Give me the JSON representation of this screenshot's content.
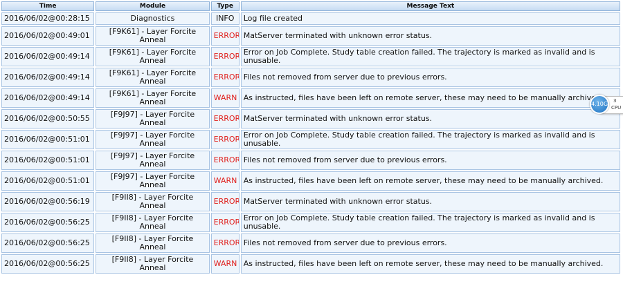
{
  "columns": {
    "time": "Time",
    "module": "Module",
    "type": "Type",
    "message": "Message Text"
  },
  "rows": [
    {
      "time": "2016/06/02@00:28:15",
      "module": "Diagnostics",
      "type": "INFO",
      "message": "Log file created"
    },
    {
      "time": "2016/06/02@00:49:01",
      "module": "[F9K61] - Layer Forcite Anneal",
      "type": "ERROR",
      "message": "MatServer terminated with unknown error status."
    },
    {
      "time": "2016/06/02@00:49:14",
      "module": "[F9K61] - Layer Forcite Anneal",
      "type": "ERROR",
      "message": "Error on Job Complete. Study table creation failed. The trajectory is marked as invalid and is unusable."
    },
    {
      "time": "2016/06/02@00:49:14",
      "module": "[F9K61] - Layer Forcite Anneal",
      "type": "ERROR",
      "message": "Files not removed from server due to previous errors."
    },
    {
      "time": "2016/06/02@00:49:14",
      "module": "[F9K61] - Layer Forcite Anneal",
      "type": "WARN",
      "message": "As instructed, files have been left on remote server, these may need to be manually archived."
    },
    {
      "time": "2016/06/02@00:50:55",
      "module": "[F9J97] - Layer Forcite Anneal",
      "type": "ERROR",
      "message": "MatServer terminated with unknown error status."
    },
    {
      "time": "2016/06/02@00:51:01",
      "module": "[F9J97] - Layer Forcite Anneal",
      "type": "ERROR",
      "message": "Error on Job Complete. Study table creation failed. The trajectory is marked as invalid and is unusable."
    },
    {
      "time": "2016/06/02@00:51:01",
      "module": "[F9J97] - Layer Forcite Anneal",
      "type": "ERROR",
      "message": "Files not removed from server due to previous errors."
    },
    {
      "time": "2016/06/02@00:51:01",
      "module": "[F9J97] - Layer Forcite Anneal",
      "type": "WARN",
      "message": "As instructed, files have been left on remote server, these may need to be manually archived."
    },
    {
      "time": "2016/06/02@00:56:19",
      "module": "[F9II8] - Layer Forcite Anneal",
      "type": "ERROR",
      "message": "MatServer terminated with unknown error status."
    },
    {
      "time": "2016/06/02@00:56:25",
      "module": "[F9II8] - Layer Forcite Anneal",
      "type": "ERROR",
      "message": "Error on Job Complete. Study table creation failed. The trajectory is marked as invalid and is unusable."
    },
    {
      "time": "2016/06/02@00:56:25",
      "module": "[F9II8] - Layer Forcite Anneal",
      "type": "ERROR",
      "message": "Files not removed from server due to previous errors."
    },
    {
      "time": "2016/06/02@00:56:25",
      "module": "[F9II8] - Layer Forcite Anneal",
      "type": "WARN",
      "message": "As instructed, files have been left on remote server, these may need to be manually archived."
    }
  ],
  "cpu_widget": {
    "memory": "4.10G",
    "value": "3",
    "label": "CPU"
  },
  "colors": {
    "error": "#e0201e",
    "warn": "#e0201e",
    "header_bg": "#c6dcf3",
    "cell_bg": "#eef5fc"
  }
}
